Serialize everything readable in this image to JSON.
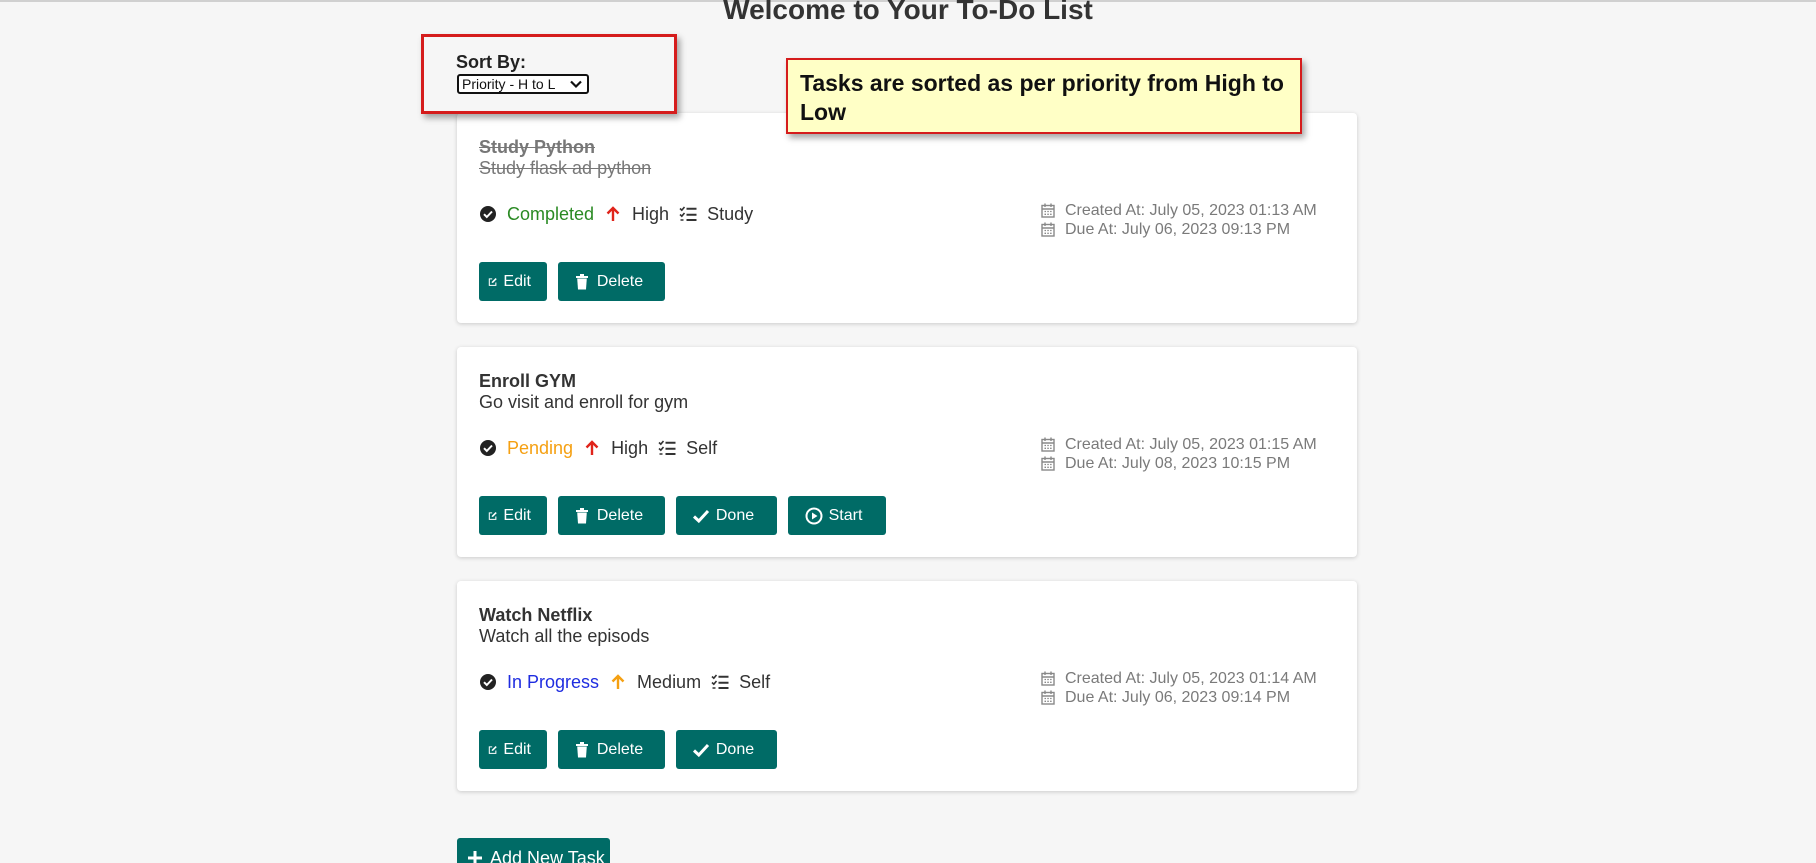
{
  "page": {
    "title": "Welcome to Your To-Do List"
  },
  "sort": {
    "label": "Sort By:",
    "selected": "Priority - H to L"
  },
  "annotation": {
    "text": "Tasks are sorted as per priority from High to Low"
  },
  "colors": {
    "button": "#006b66",
    "status_completed": "#2a8a23",
    "status_pending": "#f5a012",
    "status_in_progress": "#1f2de0",
    "priority_high": "#e0241b",
    "priority_medium": "#f5a012",
    "annotation_border": "#d51c1c",
    "annotation_bg": "#ffffc6"
  },
  "tasks": [
    {
      "title": "Study Python",
      "description": "Study flask ad python",
      "status": "Completed",
      "priority": "High",
      "category": "Study",
      "created": "Created At: July 05, 2023 01:13 AM",
      "due": "Due At: July 06, 2023 09:13 PM",
      "buttons": [
        "Edit",
        "Delete"
      ]
    },
    {
      "title": "Enroll GYM",
      "description": "Go visit and enroll for gym",
      "status": "Pending",
      "priority": "High",
      "category": "Self",
      "created": "Created At: July 05, 2023 01:15 AM",
      "due": "Due At: July 08, 2023 10:15 PM",
      "buttons": [
        "Edit",
        "Delete",
        "Done",
        "Start"
      ]
    },
    {
      "title": "Watch Netflix",
      "description": "Watch all the episods",
      "status": "In Progress",
      "priority": "Medium",
      "category": "Self",
      "created": "Created At: July 05, 2023 01:14 AM",
      "due": "Due At: July 06, 2023 09:14 PM",
      "buttons": [
        "Edit",
        "Delete",
        "Done"
      ]
    }
  ],
  "add_button": {
    "label": "Add New Task"
  }
}
